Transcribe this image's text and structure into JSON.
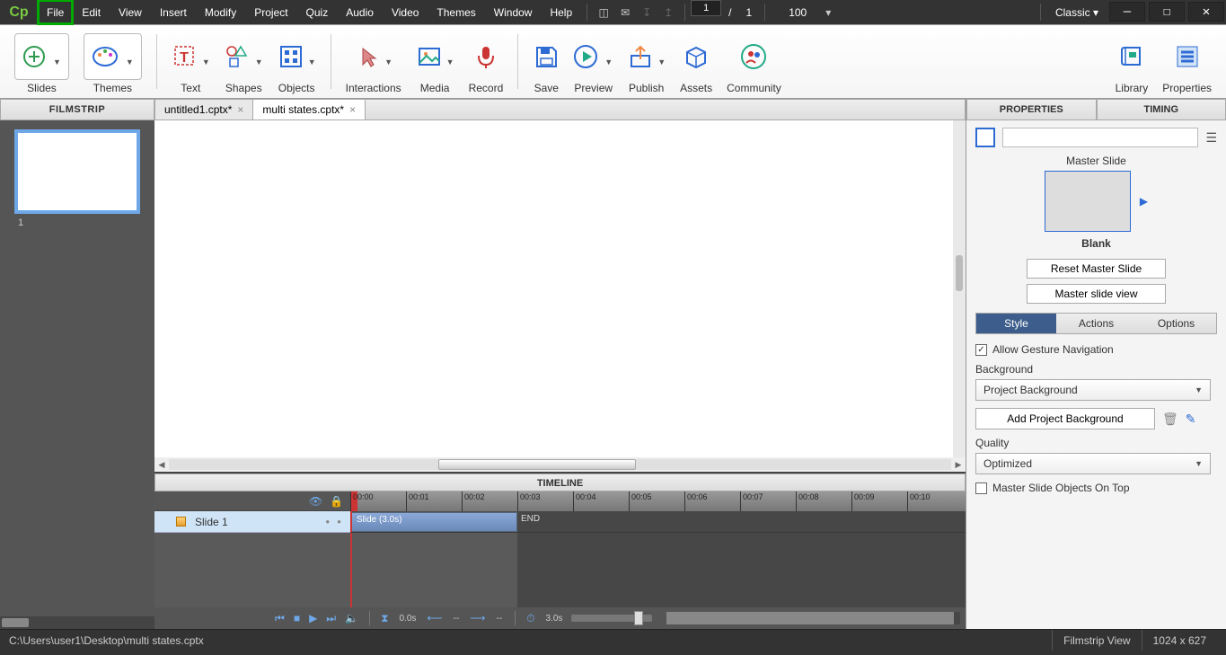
{
  "menubar": {
    "logo": "Cp",
    "items": [
      "File",
      "Edit",
      "View",
      "Insert",
      "Modify",
      "Project",
      "Quiz",
      "Audio",
      "Video",
      "Themes",
      "Window",
      "Help"
    ],
    "highlighted_idx": 0,
    "page_cur": "1",
    "page_sep": "/",
    "page_total": "1",
    "zoom": "100",
    "workspace": "Classic"
  },
  "ribbon": [
    {
      "label": "Slides",
      "dd": true,
      "boxed": true,
      "icon": "plus-circle"
    },
    {
      "label": "Themes",
      "dd": true,
      "boxed": true,
      "icon": "palette"
    },
    {
      "sep": true
    },
    {
      "label": "Text",
      "dd": true,
      "icon": "text"
    },
    {
      "label": "Shapes",
      "dd": true,
      "icon": "shapes"
    },
    {
      "label": "Objects",
      "dd": true,
      "icon": "grid"
    },
    {
      "sep": true
    },
    {
      "label": "Interactions",
      "dd": true,
      "icon": "cursor"
    },
    {
      "label": "Media",
      "dd": true,
      "icon": "image"
    },
    {
      "label": "Record",
      "icon": "mic"
    },
    {
      "sep": true
    },
    {
      "label": "Save",
      "icon": "save"
    },
    {
      "label": "Preview",
      "dd": true,
      "icon": "play-circle"
    },
    {
      "label": "Publish",
      "dd": true,
      "icon": "upload"
    },
    {
      "label": "Assets",
      "icon": "box"
    },
    {
      "label": "Community",
      "icon": "users"
    },
    {
      "flex": true
    },
    {
      "label": "Library",
      "icon": "book"
    },
    {
      "label": "Properties",
      "icon": "menu"
    }
  ],
  "filmstrip": {
    "title": "FILMSTRIP",
    "thumb_num": "1"
  },
  "tabs": [
    {
      "label": "untitled1.cptx*",
      "active": false
    },
    {
      "label": "multi states.cptx*",
      "active": true
    }
  ],
  "timeline": {
    "title": "TIMELINE",
    "row_label": "Slide 1",
    "clip_label": "Slide (3.0s)",
    "end_label": "END",
    "ticks": [
      "00:00",
      "00:01",
      "00:02",
      "00:03",
      "00:04",
      "00:05",
      "00:06",
      "00:07",
      "00:08",
      "00:09",
      "00:10"
    ],
    "controls": {
      "time_cur": "0.0s",
      "sel_start": "--",
      "sel_end": "--",
      "total": "3.0s"
    }
  },
  "properties": {
    "tabs": [
      "PROPERTIES",
      "TIMING"
    ],
    "master_slide_title": "Master Slide",
    "master_slide_name": "Blank",
    "reset_btn": "Reset Master Slide",
    "view_btn": "Master slide view",
    "subtabs": [
      "Style",
      "Actions",
      "Options"
    ],
    "allow_gesture": "Allow Gesture Navigation",
    "background_lbl": "Background",
    "background_val": "Project Background",
    "add_bg_btn": "Add Project Background",
    "quality_lbl": "Quality",
    "quality_val": "Optimized",
    "ms_on_top": "Master Slide Objects On Top"
  },
  "statusbar": {
    "path": "C:\\Users\\user1\\Desktop\\multi states.cptx",
    "view": "Filmstrip View",
    "dims": "1024 x 627"
  }
}
